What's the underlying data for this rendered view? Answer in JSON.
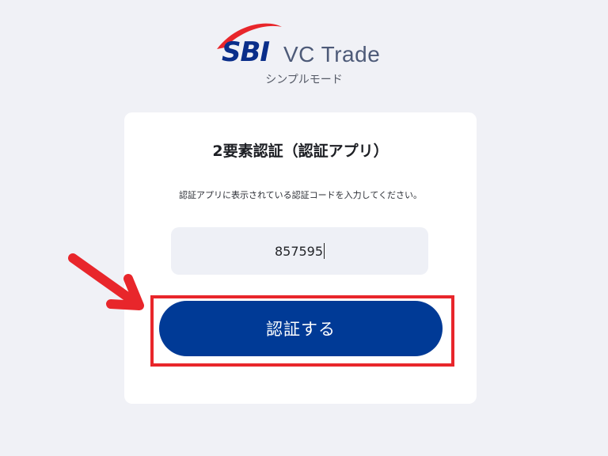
{
  "logo": {
    "brand": "SBI",
    "product": "VC Trade",
    "brand_color": "#0a2e8a",
    "swoosh_color": "#e8262b"
  },
  "mode_label": "シンプルモード",
  "card": {
    "title": "2要素認証（認証アプリ）",
    "instruction": "認証アプリに表示されている認証コードを入力してください。",
    "code_input": {
      "value": "857595"
    },
    "submit_label": "認証する",
    "submit_color": "#003a96"
  },
  "annotation": {
    "highlight_color": "#e8262b",
    "arrow_icon": "arrow-right-icon"
  }
}
